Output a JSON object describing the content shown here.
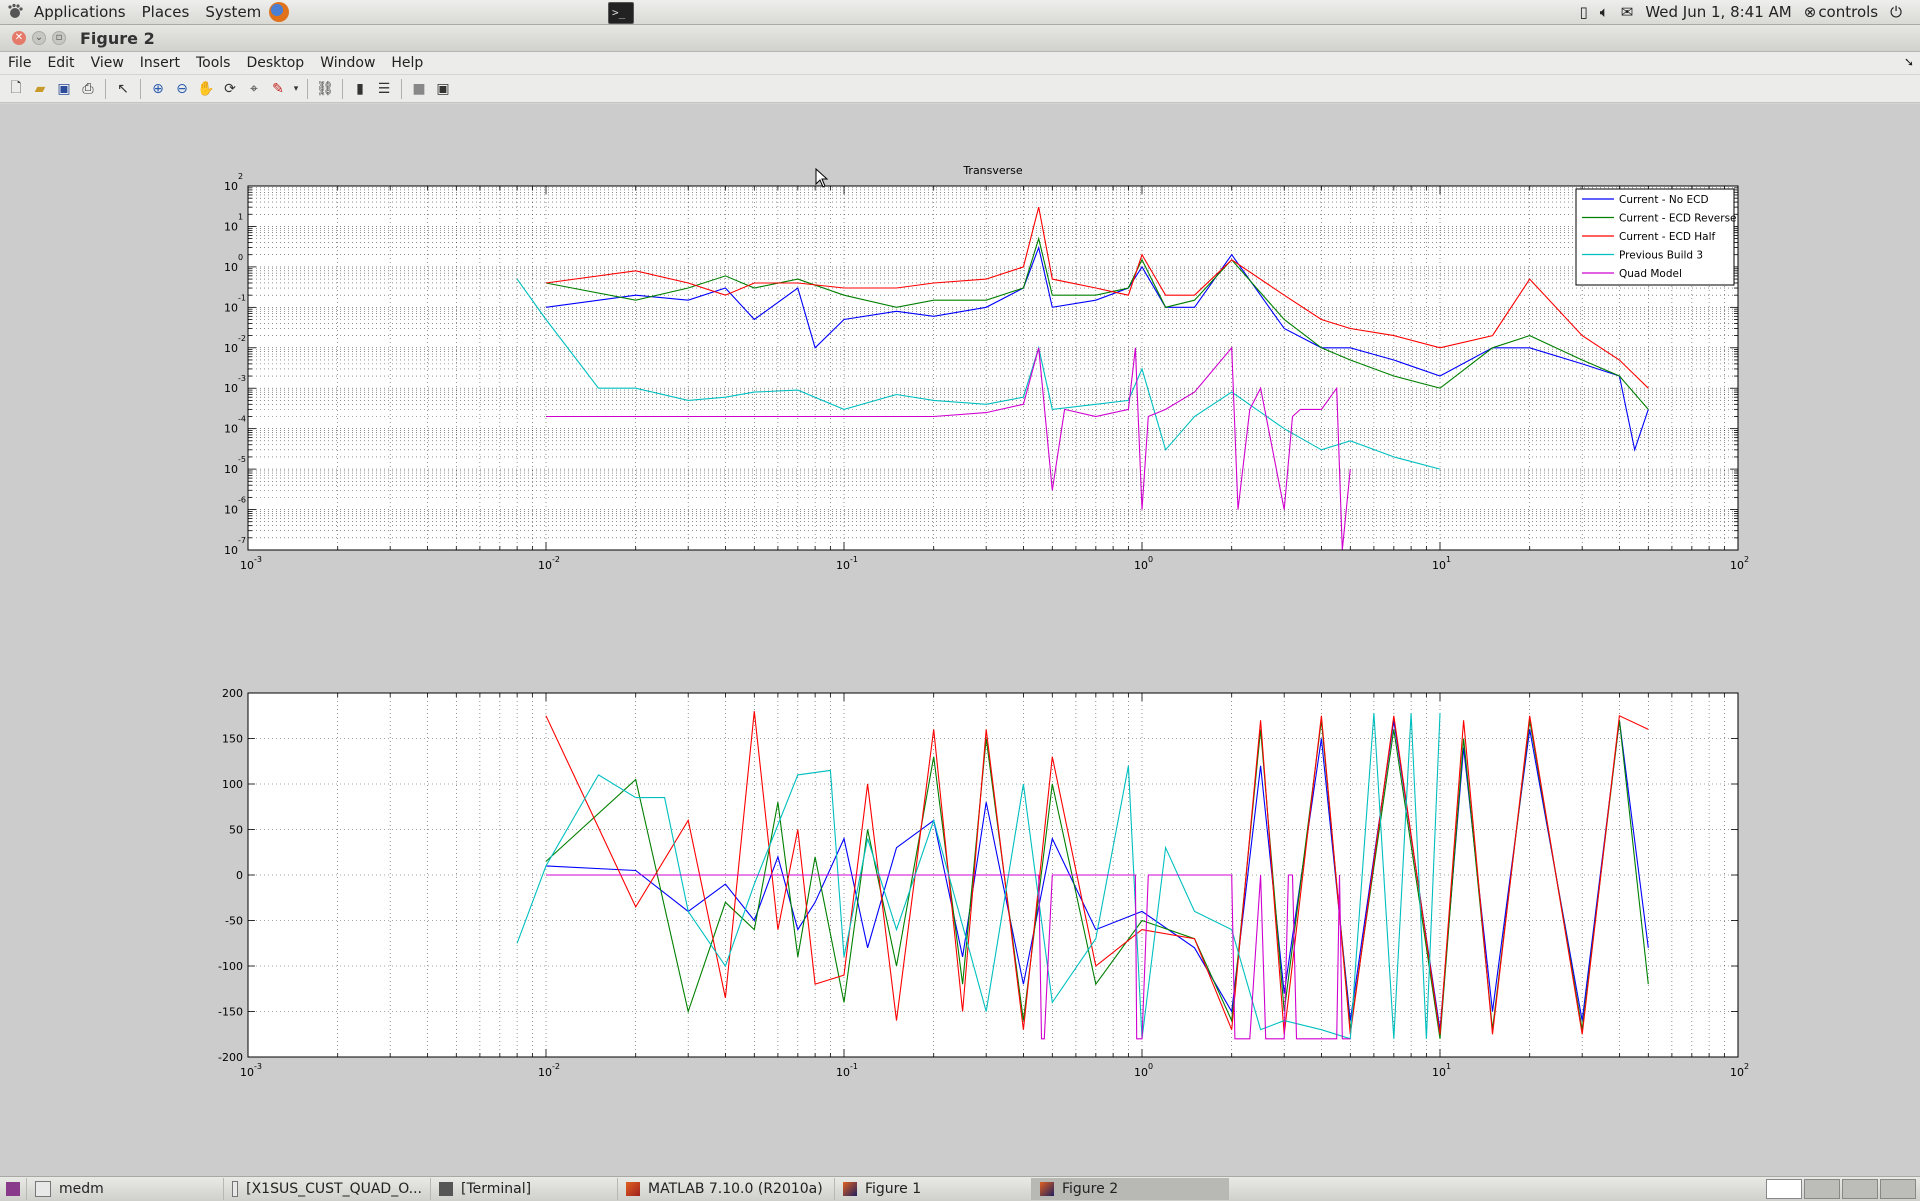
{
  "top_panel": {
    "menus": [
      "Applications",
      "Places",
      "System"
    ],
    "clock": "Wed Jun  1,  8:41 AM",
    "user": "controls"
  },
  "window": {
    "title": "Figure 2",
    "menu_items": [
      "File",
      "Edit",
      "View",
      "Insert",
      "Tools",
      "Desktop",
      "Window",
      "Help"
    ],
    "toolbar_icons": [
      "new-figure-icon",
      "open-file-icon",
      "save-icon",
      "print-icon",
      "pointer-icon",
      "zoom-in-icon",
      "zoom-out-icon",
      "pan-icon",
      "rotate-icon",
      "data-cursor-icon",
      "brush-icon",
      "link-icon",
      "colorbar-icon",
      "legend-icon",
      "hide-plot-tools-icon",
      "show-plot-tools-icon"
    ]
  },
  "chart_data": [
    {
      "type": "line",
      "title": "Transverse",
      "xscale": "log",
      "yscale": "log",
      "xlim": [
        0.001,
        100
      ],
      "ylim": [
        1e-07,
        100
      ],
      "x_tick_labels": [
        "10",
        "10",
        "10",
        "10",
        "10",
        "10"
      ],
      "x_tick_exponents": [
        "-3",
        "-2",
        "-1",
        "0",
        "1",
        "2"
      ],
      "y_tick_labels": [
        "10",
        "10",
        "10",
        "10",
        "10",
        "10",
        "10",
        "10",
        "10",
        "10"
      ],
      "y_tick_exponents": [
        "2",
        "1",
        "0",
        "-1",
        "-2",
        "-3",
        "-4",
        "-5",
        "-6",
        "-7"
      ],
      "grid": true,
      "legend_position": "top-right",
      "series": [
        {
          "name": "Current - No ECD",
          "color": "#0000ff",
          "x": [
            0.01,
            0.02,
            0.03,
            0.04,
            0.05,
            0.07,
            0.08,
            0.1,
            0.15,
            0.2,
            0.3,
            0.4,
            0.45,
            0.5,
            0.7,
            0.9,
            1.0,
            1.2,
            1.5,
            2.0,
            3.0,
            4.0,
            5.0,
            7.0,
            10.0,
            15.0,
            20.0,
            30.0,
            40.0,
            45.0,
            50.0
          ],
          "y": [
            0.1,
            0.2,
            0.15,
            0.3,
            0.05,
            0.3,
            0.01,
            0.05,
            0.08,
            0.06,
            0.1,
            0.3,
            3.0,
            0.1,
            0.15,
            0.3,
            1.0,
            0.1,
            0.1,
            2.0,
            0.03,
            0.01,
            0.01,
            0.005,
            0.002,
            0.01,
            0.01,
            0.004,
            0.002,
            3e-05,
            0.0003
          ]
        },
        {
          "name": "Current - ECD Reverse",
          "color": "#008000",
          "x": [
            0.01,
            0.02,
            0.03,
            0.04,
            0.05,
            0.07,
            0.1,
            0.15,
            0.2,
            0.3,
            0.4,
            0.45,
            0.5,
            0.7,
            0.9,
            1.0,
            1.2,
            1.5,
            2.0,
            3.0,
            4.0,
            5.0,
            7.0,
            10.0,
            15.0,
            20.0,
            30.0,
            40.0,
            50.0
          ],
          "y": [
            0.4,
            0.15,
            0.3,
            0.6,
            0.3,
            0.5,
            0.2,
            0.1,
            0.15,
            0.15,
            0.3,
            5.0,
            0.2,
            0.2,
            0.3,
            1.5,
            0.1,
            0.15,
            1.5,
            0.05,
            0.01,
            0.005,
            0.002,
            0.001,
            0.01,
            0.02,
            0.005,
            0.002,
            0.0003
          ]
        },
        {
          "name": "Current - ECD Half",
          "color": "#ff0000",
          "x": [
            0.01,
            0.02,
            0.03,
            0.04,
            0.05,
            0.07,
            0.1,
            0.15,
            0.2,
            0.3,
            0.4,
            0.45,
            0.5,
            0.7,
            0.9,
            1.0,
            1.2,
            1.5,
            2.0,
            3.0,
            4.0,
            5.0,
            7.0,
            10.0,
            15.0,
            20.0,
            30.0,
            40.0,
            50.0
          ],
          "y": [
            0.4,
            0.8,
            0.4,
            0.2,
            0.4,
            0.4,
            0.3,
            0.3,
            0.4,
            0.5,
            1.0,
            30.0,
            0.5,
            0.3,
            0.2,
            2.0,
            0.2,
            0.2,
            1.5,
            0.2,
            0.05,
            0.03,
            0.02,
            0.01,
            0.02,
            0.5,
            0.02,
            0.005,
            0.001
          ]
        },
        {
          "name": "Previous Build 3",
          "color": "#00bfbf",
          "x": [
            0.008,
            0.01,
            0.015,
            0.02,
            0.03,
            0.04,
            0.05,
            0.07,
            0.1,
            0.15,
            0.2,
            0.3,
            0.4,
            0.45,
            0.5,
            0.7,
            0.9,
            1.0,
            1.2,
            1.5,
            2.0,
            3.0,
            4.0,
            5.0,
            7.0,
            10.0
          ],
          "y": [
            0.5,
            0.05,
            0.001,
            0.001,
            0.0005,
            0.0006,
            0.0008,
            0.0009,
            0.0003,
            0.0007,
            0.0005,
            0.0004,
            0.0006,
            0.01,
            0.0003,
            0.0004,
            0.0005,
            0.003,
            3e-05,
            0.0002,
            0.0008,
            0.0001,
            3e-05,
            5e-05,
            2e-05,
            1e-05
          ]
        },
        {
          "name": "Quad Model",
          "color": "#d000d0",
          "x": [
            0.01,
            0.05,
            0.1,
            0.2,
            0.3,
            0.4,
            0.45,
            0.5,
            0.55,
            0.7,
            0.9,
            0.95,
            1.0,
            1.05,
            1.2,
            1.5,
            2.0,
            2.1,
            2.3,
            2.5,
            3.0,
            3.2,
            3.4,
            4.0,
            4.5,
            4.7,
            5.0
          ],
          "y": [
            0.0002,
            0.0002,
            0.0002,
            0.0002,
            0.00025,
            0.0004,
            0.01,
            3e-06,
            0.0003,
            0.0002,
            0.0003,
            0.01,
            1e-06,
            0.0002,
            0.0003,
            0.0008,
            0.01,
            1e-06,
            0.0003,
            0.001,
            1e-06,
            0.0002,
            0.0003,
            0.0003,
            0.001,
            1e-07,
            1e-05
          ]
        }
      ]
    },
    {
      "type": "line",
      "title": "",
      "xscale": "log",
      "xlim": [
        0.001,
        100
      ],
      "ylim": [
        -200,
        200
      ],
      "x_tick_labels": [
        "10",
        "10",
        "10",
        "10",
        "10",
        "10"
      ],
      "x_tick_exponents": [
        "-3",
        "-2",
        "-1",
        "0",
        "1",
        "2"
      ],
      "y_tick_labels": [
        "200",
        "150",
        "100",
        "50",
        "0",
        "-50",
        "-100",
        "-150",
        "-200"
      ],
      "grid": true,
      "series": [
        {
          "name": "Current - No ECD",
          "color": "#0000ff",
          "x": [
            0.01,
            0.02,
            0.03,
            0.04,
            0.05,
            0.06,
            0.07,
            0.08,
            0.1,
            0.12,
            0.15,
            0.2,
            0.25,
            0.3,
            0.4,
            0.5,
            0.7,
            1.0,
            1.5,
            2.0,
            2.5,
            3.0,
            4.0,
            5.0,
            7.0,
            10.0,
            12.0,
            15.0,
            20.0,
            30.0,
            40.0,
            50.0
          ],
          "y": [
            10,
            5,
            -40,
            -10,
            -50,
            20,
            -60,
            -30,
            40,
            -80,
            30,
            60,
            -90,
            80,
            -120,
            40,
            -60,
            -40,
            -80,
            -150,
            120,
            -130,
            150,
            -160,
            170,
            -170,
            140,
            -150,
            160,
            -160,
            170,
            -80
          ]
        },
        {
          "name": "Current - ECD Reverse",
          "color": "#008000",
          "x": [
            0.01,
            0.02,
            0.03,
            0.04,
            0.05,
            0.06,
            0.07,
            0.08,
            0.1,
            0.12,
            0.15,
            0.2,
            0.25,
            0.3,
            0.4,
            0.5,
            0.7,
            1.0,
            1.5,
            2.0,
            2.5,
            3.0,
            4.0,
            5.0,
            7.0,
            10.0,
            12.0,
            15.0,
            20.0,
            30.0,
            40.0,
            50.0
          ],
          "y": [
            15,
            105,
            -150,
            -30,
            -60,
            80,
            -90,
            20,
            -140,
            50,
            -100,
            130,
            -120,
            150,
            -160,
            100,
            -120,
            -50,
            -70,
            -160,
            160,
            -150,
            170,
            -170,
            160,
            -180,
            150,
            -170,
            170,
            -170,
            170,
            -120
          ]
        },
        {
          "name": "Current - ECD Half",
          "color": "#ff0000",
          "x": [
            0.01,
            0.02,
            0.03,
            0.04,
            0.05,
            0.06,
            0.07,
            0.08,
            0.1,
            0.12,
            0.15,
            0.2,
            0.25,
            0.3,
            0.4,
            0.5,
            0.7,
            1.0,
            1.5,
            2.0,
            2.5,
            3.0,
            4.0,
            5.0,
            7.0,
            10.0,
            12.0,
            15.0,
            20.0,
            30.0,
            40.0,
            50.0
          ],
          "y": [
            175,
            -35,
            60,
            -135,
            180,
            -60,
            50,
            -120,
            -110,
            100,
            -160,
            160,
            -150,
            160,
            -170,
            130,
            -100,
            -60,
            -70,
            -170,
            170,
            -175,
            175,
            -175,
            175,
            -175,
            170,
            -175,
            175,
            -175,
            175,
            160
          ]
        },
        {
          "name": "Previous Build 3",
          "color": "#00bfbf",
          "x": [
            0.008,
            0.01,
            0.015,
            0.02,
            0.025,
            0.03,
            0.04,
            0.05,
            0.07,
            0.09,
            0.1,
            0.12,
            0.15,
            0.2,
            0.3,
            0.4,
            0.5,
            0.7,
            0.9,
            1.0,
            1.2,
            1.5,
            2.0,
            2.5,
            3.0,
            4.0,
            5.0,
            6.0,
            7.0,
            8.0,
            9.0,
            10.0
          ],
          "y": [
            -75,
            10,
            110,
            85,
            85,
            -40,
            -100,
            -10,
            110,
            115,
            -90,
            40,
            -60,
            60,
            -150,
            100,
            -140,
            -70,
            120,
            -180,
            30,
            -40,
            -60,
            -170,
            -160,
            -170,
            -180,
            178,
            -180,
            178,
            -180,
            178
          ]
        },
        {
          "name": "Quad Model",
          "color": "#d000d0",
          "x": [
            0.01,
            0.1,
            0.2,
            0.3,
            0.45,
            0.46,
            0.47,
            0.5,
            0.9,
            0.95,
            0.96,
            1.0,
            1.05,
            1.9,
            2.0,
            2.05,
            2.1,
            2.3,
            2.5,
            2.6,
            3.0,
            3.1,
            3.2,
            3.3,
            4.0,
            4.5,
            4.6,
            4.7,
            5.0
          ],
          "y": [
            0,
            0,
            0,
            0,
            0,
            -180,
            -180,
            0,
            0,
            0,
            -180,
            -180,
            0,
            0,
            0,
            -180,
            -180,
            -180,
            0,
            -180,
            -180,
            0,
            0,
            -180,
            -180,
            -180,
            0,
            -180,
            -180
          ]
        }
      ]
    }
  ],
  "taskbar": {
    "tasks": [
      "medm",
      "[X1SUS_CUST_QUAD_O...",
      "[Terminal]",
      "MATLAB  7.10.0 (R2010a)",
      "Figure 1",
      "Figure 2"
    ],
    "active_task": "Figure 2"
  }
}
